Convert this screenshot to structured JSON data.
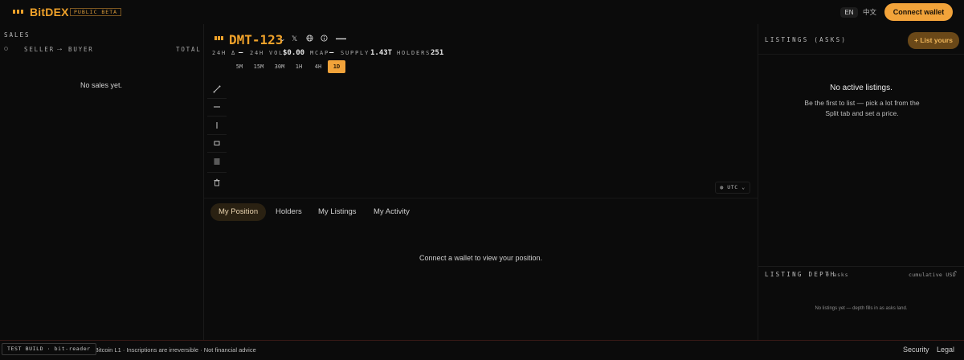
{
  "header": {
    "brand": "BitDEX",
    "badge": "PUBLIC BETA",
    "lang_en": "EN",
    "lang_zh": "中文",
    "connect_wallet": "Connect wallet"
  },
  "sales": {
    "title": "SALES",
    "col_seller": "SELLER",
    "col_arrow": "→",
    "col_buyer": "BUYER",
    "col_total": "TOTAL",
    "empty": "No sales yet."
  },
  "token": {
    "name": "DMT-123",
    "price": "—",
    "stats": {
      "delta_label": "24H Δ",
      "delta_value": "—",
      "vol_label": "24H VOL",
      "vol_value": "$0.00",
      "mcap_label": "MCAP",
      "mcap_value": "—",
      "supply_label": "SUPPLY",
      "supply_value": "1.43T",
      "holders_label": "HOLDERS",
      "holders_value": "251"
    },
    "timeframes": [
      "5M",
      "15M",
      "30M",
      "1H",
      "4H",
      "1D"
    ],
    "active_timeframe": "1D",
    "timezone": "UTC"
  },
  "drawing_tools": [
    "trend-line-icon",
    "horizontal-line-icon",
    "vertical-line-icon",
    "rectangle-icon",
    "fib-levels-icon",
    "trash-icon"
  ],
  "position_tabs": [
    "My Position",
    "Holders",
    "My Listings",
    "My Activity"
  ],
  "active_position_tab": "My Position",
  "position_message": "Connect a wallet to view your position.",
  "listings": {
    "title": "LISTINGS (ASKS)",
    "list_button": "+ List yours",
    "empty_title": "No active listings.",
    "empty_body": "Be the first to list — pick a lot from the Split tab and set a price."
  },
  "depth": {
    "title": "LISTING DEPTH",
    "count": "0 asks",
    "mode": "cumulative USD",
    "empty": "No listings yet — depth fills in as asks land."
  },
  "footer": {
    "build": "TEST BUILD · bit-reader",
    "tagline": "3 · Bitcoin L1 · Inscriptions are irreversible · Not financial advice",
    "security": "Security",
    "legal": "Legal"
  },
  "colors": {
    "accent": "#f2a33a",
    "background": "#0b0b0b"
  }
}
